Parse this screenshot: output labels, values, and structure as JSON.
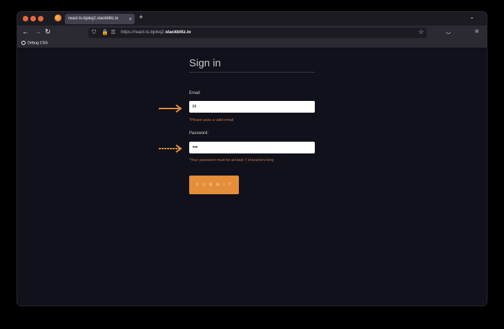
{
  "browser": {
    "tab_title": "react-ts-bjokq2.stackblitz.io",
    "tab_close": "×",
    "new_tab": "+",
    "tab_list": "⌄",
    "url_prefix": "https://react-ts-bjokq2.",
    "url_host": "stackblitz.io",
    "bookmark_label": "Debug CSS"
  },
  "icons": {
    "back": "←",
    "forward": "→",
    "reload": "↻",
    "shield": "⛉",
    "lock": "🔒",
    "key": "⚿",
    "star": "☆",
    "pocket": "◡",
    "menu": "≡"
  },
  "form": {
    "title": "Sign in",
    "email_label": "Email:",
    "email_value": "H",
    "email_error": "*Please pass a valid email",
    "password_label": "Password:",
    "password_value": "•••",
    "password_error": "*Your password must be at least 7 characters long",
    "submit_label": "S U B M I T"
  },
  "colors": {
    "accent": "#e58e3a",
    "background": "#11111c",
    "arrow": "#e58e3a"
  }
}
